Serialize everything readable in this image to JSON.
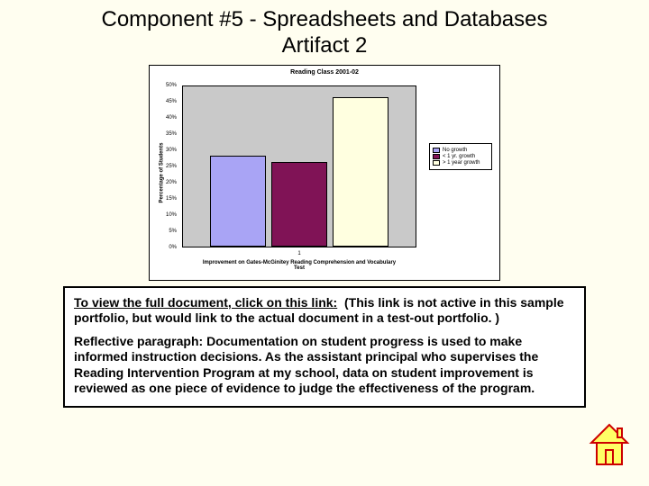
{
  "title_line1": "Component #5 - Spreadsheets and Databases",
  "title_line2": "Artifact 2",
  "chart_data": {
    "type": "bar",
    "title": "Reading Class 2001-02",
    "ylabel": "Percentage of Students",
    "xlabel_line1": "Improvement on Gates-McGinitey Reading Comprehension and Vocabulary",
    "xlabel_line2": "Test",
    "categories": [
      "1"
    ],
    "series": [
      {
        "name": "No growth",
        "values": [
          28
        ],
        "color": "#a9a4f5"
      },
      {
        "name": "< 1 yr. growth",
        "values": [
          26
        ],
        "color": "#801356"
      },
      {
        "name": "> 1 year growth",
        "values": [
          46
        ],
        "color": "#ffffe0"
      }
    ],
    "yticks": [
      "0%",
      "5%",
      "10%",
      "15%",
      "20%",
      "25%",
      "30%",
      "35%",
      "40%",
      "45%",
      "50%"
    ],
    "ylim": [
      0,
      50
    ]
  },
  "textbox": {
    "link_text": "To view the full document, click on this link:",
    "link_note": "(This link is not active in this sample portfolio, but would link to the actual document in a test-out portfolio. )",
    "reflect_label": "Reflective paragraph:",
    "reflect_body": "Documentation on student progress is used to make informed instruction decisions.  As the assistant principal who supervises the Reading Intervention Program at my school, data on student improvement is reviewed as one piece of evidence to judge the effectiveness of the program."
  }
}
